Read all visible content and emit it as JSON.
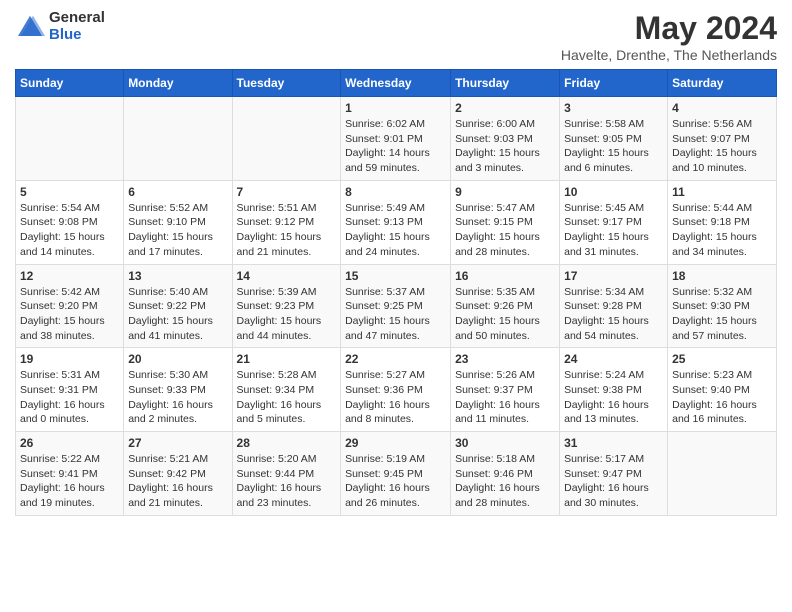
{
  "logo": {
    "general": "General",
    "blue": "Blue"
  },
  "title": "May 2024",
  "subtitle": "Havelte, Drenthe, The Netherlands",
  "headers": [
    "Sunday",
    "Monday",
    "Tuesday",
    "Wednesday",
    "Thursday",
    "Friday",
    "Saturday"
  ],
  "weeks": [
    [
      {
        "day": "",
        "details": ""
      },
      {
        "day": "",
        "details": ""
      },
      {
        "day": "",
        "details": ""
      },
      {
        "day": "1",
        "details": "Sunrise: 6:02 AM\nSunset: 9:01 PM\nDaylight: 14 hours and 59 minutes."
      },
      {
        "day": "2",
        "details": "Sunrise: 6:00 AM\nSunset: 9:03 PM\nDaylight: 15 hours and 3 minutes."
      },
      {
        "day": "3",
        "details": "Sunrise: 5:58 AM\nSunset: 9:05 PM\nDaylight: 15 hours and 6 minutes."
      },
      {
        "day": "4",
        "details": "Sunrise: 5:56 AM\nSunset: 9:07 PM\nDaylight: 15 hours and 10 minutes."
      }
    ],
    [
      {
        "day": "5",
        "details": "Sunrise: 5:54 AM\nSunset: 9:08 PM\nDaylight: 15 hours and 14 minutes."
      },
      {
        "day": "6",
        "details": "Sunrise: 5:52 AM\nSunset: 9:10 PM\nDaylight: 15 hours and 17 minutes."
      },
      {
        "day": "7",
        "details": "Sunrise: 5:51 AM\nSunset: 9:12 PM\nDaylight: 15 hours and 21 minutes."
      },
      {
        "day": "8",
        "details": "Sunrise: 5:49 AM\nSunset: 9:13 PM\nDaylight: 15 hours and 24 minutes."
      },
      {
        "day": "9",
        "details": "Sunrise: 5:47 AM\nSunset: 9:15 PM\nDaylight: 15 hours and 28 minutes."
      },
      {
        "day": "10",
        "details": "Sunrise: 5:45 AM\nSunset: 9:17 PM\nDaylight: 15 hours and 31 minutes."
      },
      {
        "day": "11",
        "details": "Sunrise: 5:44 AM\nSunset: 9:18 PM\nDaylight: 15 hours and 34 minutes."
      }
    ],
    [
      {
        "day": "12",
        "details": "Sunrise: 5:42 AM\nSunset: 9:20 PM\nDaylight: 15 hours and 38 minutes."
      },
      {
        "day": "13",
        "details": "Sunrise: 5:40 AM\nSunset: 9:22 PM\nDaylight: 15 hours and 41 minutes."
      },
      {
        "day": "14",
        "details": "Sunrise: 5:39 AM\nSunset: 9:23 PM\nDaylight: 15 hours and 44 minutes."
      },
      {
        "day": "15",
        "details": "Sunrise: 5:37 AM\nSunset: 9:25 PM\nDaylight: 15 hours and 47 minutes."
      },
      {
        "day": "16",
        "details": "Sunrise: 5:35 AM\nSunset: 9:26 PM\nDaylight: 15 hours and 50 minutes."
      },
      {
        "day": "17",
        "details": "Sunrise: 5:34 AM\nSunset: 9:28 PM\nDaylight: 15 hours and 54 minutes."
      },
      {
        "day": "18",
        "details": "Sunrise: 5:32 AM\nSunset: 9:30 PM\nDaylight: 15 hours and 57 minutes."
      }
    ],
    [
      {
        "day": "19",
        "details": "Sunrise: 5:31 AM\nSunset: 9:31 PM\nDaylight: 16 hours and 0 minutes."
      },
      {
        "day": "20",
        "details": "Sunrise: 5:30 AM\nSunset: 9:33 PM\nDaylight: 16 hours and 2 minutes."
      },
      {
        "day": "21",
        "details": "Sunrise: 5:28 AM\nSunset: 9:34 PM\nDaylight: 16 hours and 5 minutes."
      },
      {
        "day": "22",
        "details": "Sunrise: 5:27 AM\nSunset: 9:36 PM\nDaylight: 16 hours and 8 minutes."
      },
      {
        "day": "23",
        "details": "Sunrise: 5:26 AM\nSunset: 9:37 PM\nDaylight: 16 hours and 11 minutes."
      },
      {
        "day": "24",
        "details": "Sunrise: 5:24 AM\nSunset: 9:38 PM\nDaylight: 16 hours and 13 minutes."
      },
      {
        "day": "25",
        "details": "Sunrise: 5:23 AM\nSunset: 9:40 PM\nDaylight: 16 hours and 16 minutes."
      }
    ],
    [
      {
        "day": "26",
        "details": "Sunrise: 5:22 AM\nSunset: 9:41 PM\nDaylight: 16 hours and 19 minutes."
      },
      {
        "day": "27",
        "details": "Sunrise: 5:21 AM\nSunset: 9:42 PM\nDaylight: 16 hours and 21 minutes."
      },
      {
        "day": "28",
        "details": "Sunrise: 5:20 AM\nSunset: 9:44 PM\nDaylight: 16 hours and 23 minutes."
      },
      {
        "day": "29",
        "details": "Sunrise: 5:19 AM\nSunset: 9:45 PM\nDaylight: 16 hours and 26 minutes."
      },
      {
        "day": "30",
        "details": "Sunrise: 5:18 AM\nSunset: 9:46 PM\nDaylight: 16 hours and 28 minutes."
      },
      {
        "day": "31",
        "details": "Sunrise: 5:17 AM\nSunset: 9:47 PM\nDaylight: 16 hours and 30 minutes."
      },
      {
        "day": "",
        "details": ""
      }
    ]
  ]
}
